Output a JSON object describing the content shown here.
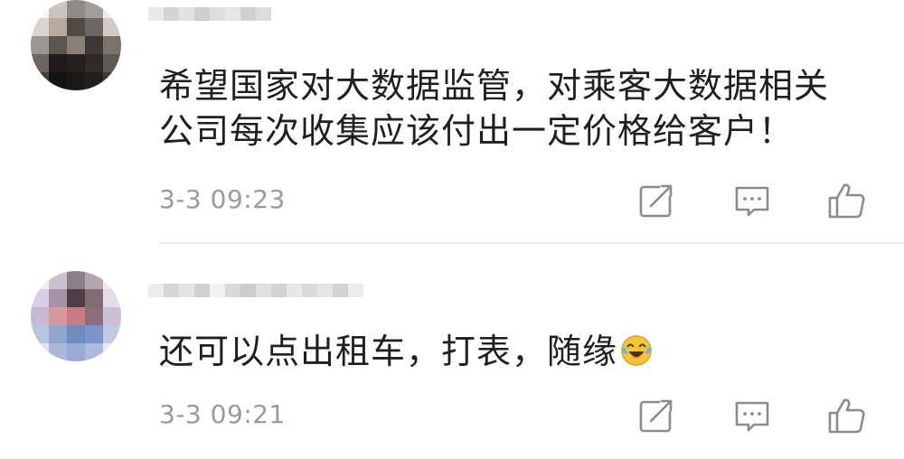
{
  "comments": [
    {
      "text_lines": [
        "希望国家对大数据监管，对乘客大数据相关",
        "公司每次收集应该付出一定价格给客户！"
      ],
      "timestamp": "3-3 09:23"
    },
    {
      "text_lines": [
        "还可以点出租车，打表，随缘"
      ],
      "emoji": "laughing-tears-emoji",
      "timestamp": "3-3 09:21"
    }
  ],
  "icons": {
    "share": "share-icon",
    "reply": "reply-icon",
    "like": "thumbs-up-icon"
  },
  "colors": {
    "text": "#1f1f1f",
    "timestamp": "#9a9a9a",
    "icon": "#8c8c8c",
    "divider": "#ececec",
    "emoji": "#f7c53a"
  }
}
